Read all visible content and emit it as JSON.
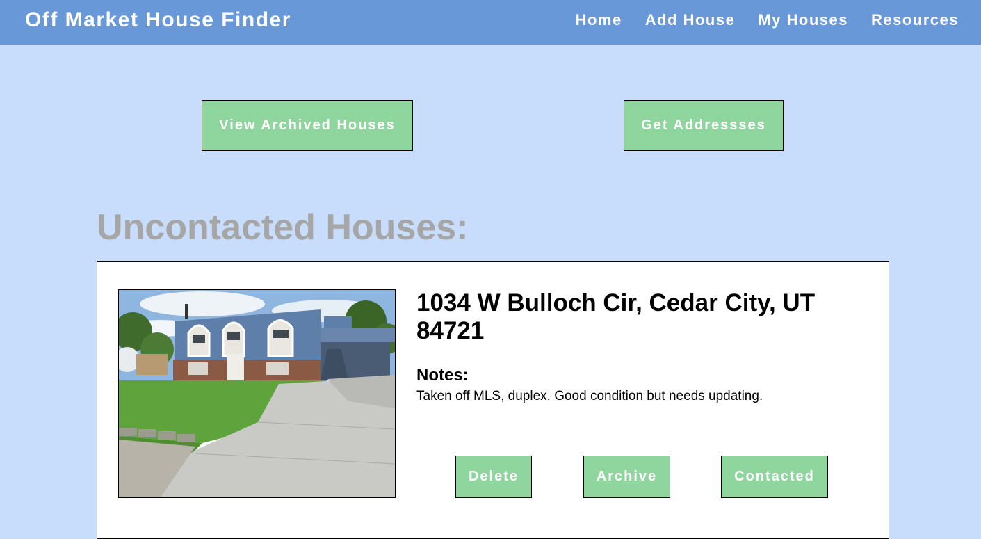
{
  "header": {
    "brand": "Off Market House Finder",
    "nav": [
      {
        "label": "Home"
      },
      {
        "label": "Add House"
      },
      {
        "label": "My Houses"
      },
      {
        "label": "Resources"
      }
    ]
  },
  "actions": {
    "view_archived_label": "View Archived Houses",
    "get_addresses_label": "Get Addressses"
  },
  "section": {
    "title": "Uncontacted Houses:"
  },
  "houses": [
    {
      "address": "1034 W Bulloch Cir, Cedar City, UT 84721",
      "notes_heading": "Notes:",
      "notes": "Taken off MLS, duplex. Good condition but needs updating.",
      "delete_label": "Delete",
      "archive_label": "Archive",
      "contacted_label": "Contacted"
    }
  ],
  "colors": {
    "navbar": "#6998d8",
    "background": "#c8ddfb",
    "button": "#8fd69e",
    "title_gray": "#a6a6a6"
  }
}
